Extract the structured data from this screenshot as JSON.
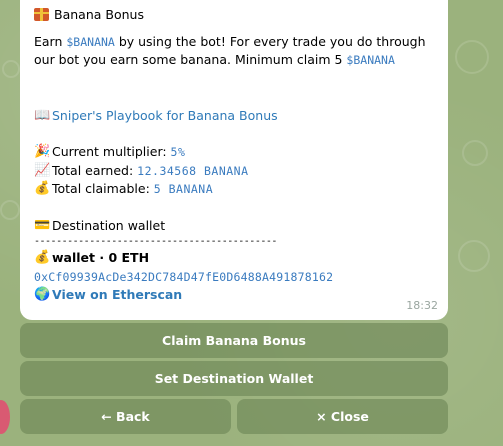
{
  "message": {
    "title_text": "Banana Bonus",
    "intro_part1": "Earn ",
    "intro_token1": "$BANANA",
    "intro_part2": " by using the bot! For every trade you do through our bot you earn some banana. Minimum claim 5 ",
    "intro_token2": "$BANANA",
    "playbook_link": "Sniper's Playbook for Banana Bonus",
    "multiplier_label": "Current multiplier: ",
    "multiplier_value": "5%",
    "earned_label": "Total earned: ",
    "earned_value": "12.34568 BANANA",
    "claimable_label": "Total claimable: ",
    "claimable_value": "5 BANANA",
    "destination_label": "Destination wallet",
    "divider": "--------------------------------------------",
    "wallet_label": "wallet · 0 ETH",
    "wallet_address": "0xCf09939AcDe342DC784D47fE0D6488A491878162",
    "etherscan_link": "View on Etherscan",
    "timestamp": "18:32"
  },
  "icons": {
    "title": "gift-icon",
    "playbook": "book-icon",
    "multiplier": "party-popper-icon",
    "earned": "chart-increasing-icon",
    "claimable": "money-bag-icon",
    "destination": "credit-card-icon",
    "wallet": "money-bag-icon",
    "etherscan": "globe-icon"
  },
  "buttons": {
    "claim": "Claim Banana Bonus",
    "set_destination": "Set Destination Wallet",
    "back": "← Back",
    "close": "× Close"
  },
  "colors": {
    "background": "#9bb27d",
    "link": "#2f7ab8",
    "code": "#3a7bbf",
    "button": "#668050"
  }
}
